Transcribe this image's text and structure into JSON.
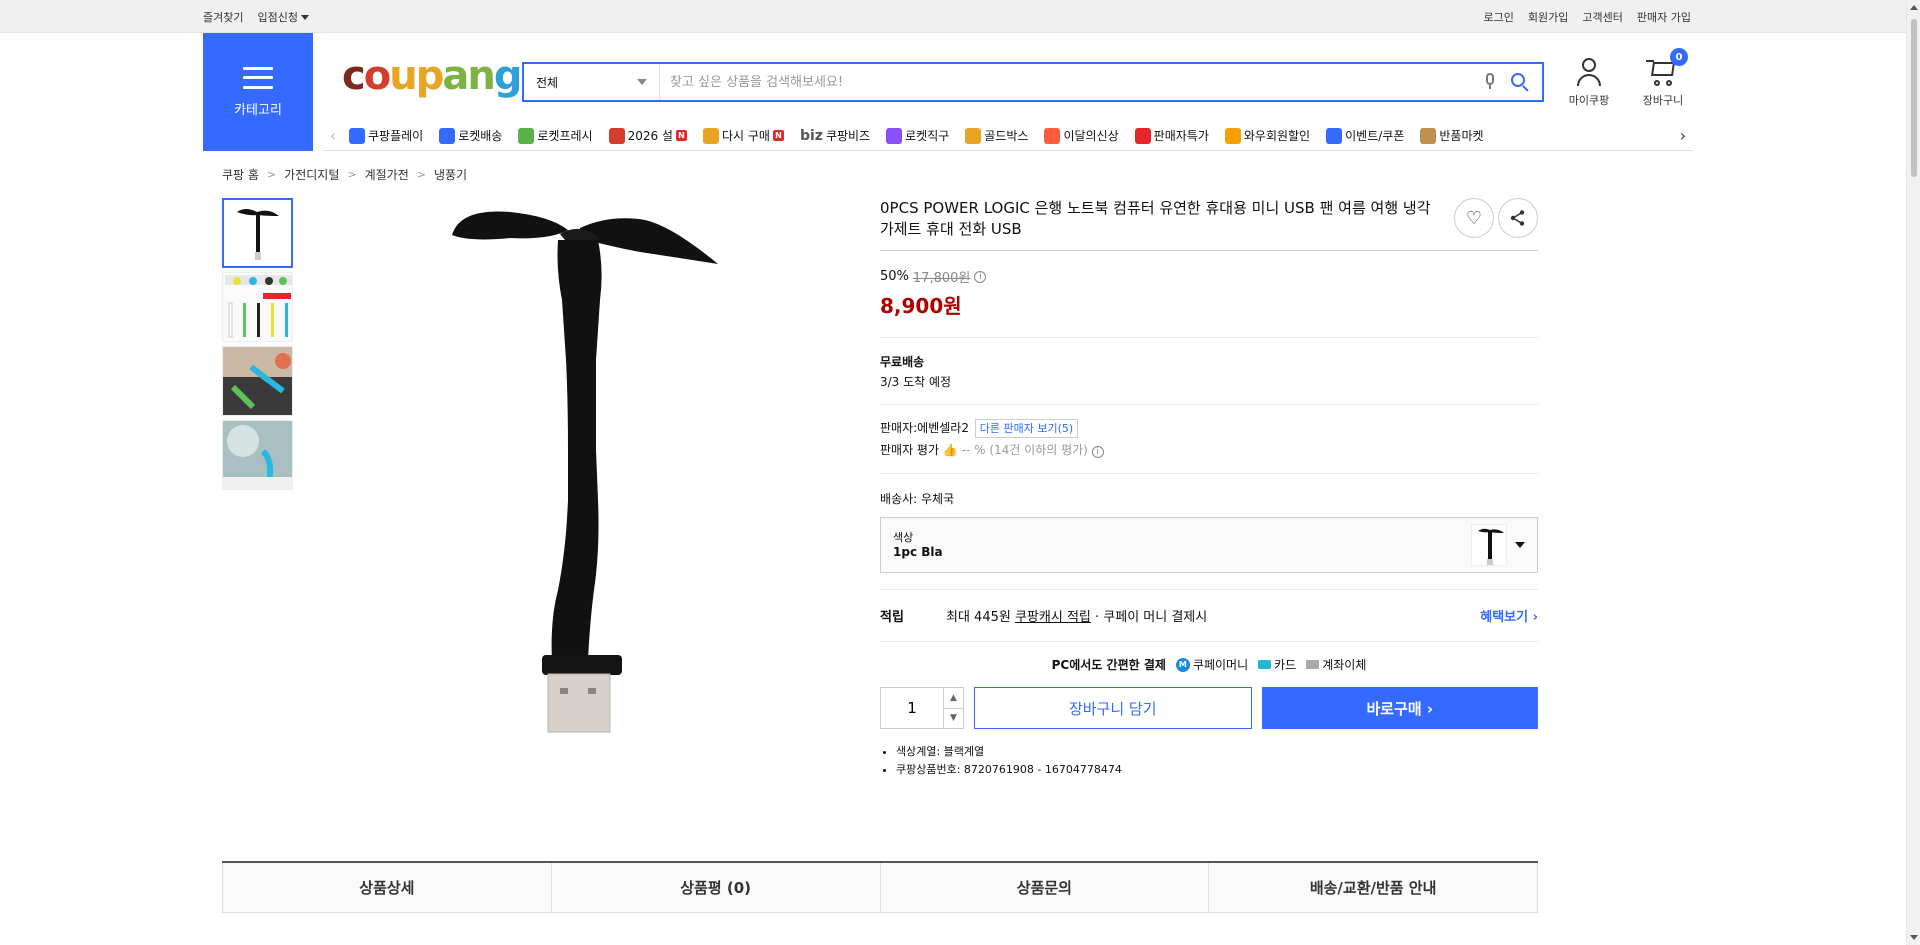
{
  "topbar": {
    "favorites": "즐겨찾기",
    "store_apply": "입점신청",
    "login": "로그인",
    "signup": "회원가입",
    "customer_center": "고객센터",
    "seller_signup": "판매자 가입"
  },
  "header": {
    "category_label": "카테고리",
    "logo_parts": [
      "c",
      "o",
      "u",
      "p",
      "a",
      "n",
      "g"
    ],
    "search_scope": "전체",
    "search_placeholder": "찾고 싶은 상품을 검색해보세요!",
    "my_coupang": "마이쿠팡",
    "cart_label": "장바구니",
    "cart_count": "0"
  },
  "quick_nav": [
    {
      "label": "쿠팡플레이",
      "icon": "play-icon",
      "color": "#346aff"
    },
    {
      "label": "로켓배송",
      "icon": "rocket-icon",
      "color": "#346aff"
    },
    {
      "label": "로켓프레시",
      "icon": "rocket-fresh-icon",
      "color": "#5ab24a"
    },
    {
      "label": "2026 설",
      "icon": "gift-icon",
      "color": "#d43d2b",
      "new": "N"
    },
    {
      "label": "다시 구매",
      "icon": "rebuy-icon",
      "color": "#e8a423",
      "new": "N"
    },
    {
      "label": "쿠팡비즈",
      "icon": "biz-icon",
      "color": "#555555",
      "prefix": "biz"
    },
    {
      "label": "로켓직구",
      "icon": "global-icon",
      "color": "#8a4ff7"
    },
    {
      "label": "골드박스",
      "icon": "goldbox-icon",
      "color": "#e8a423"
    },
    {
      "label": "이달의신상",
      "icon": "newitem-icon",
      "color": "#ff5a3c"
    },
    {
      "label": "판매자특가",
      "icon": "seller-deal-icon",
      "color": "#e52528"
    },
    {
      "label": "와우회원할인",
      "icon": "wow-icon",
      "color": "#f2a100"
    },
    {
      "label": "이벤트/쿠폰",
      "icon": "coupon-icon",
      "color": "#346aff"
    },
    {
      "label": "반품마켓",
      "icon": "return-market-icon",
      "color": "#c09050"
    }
  ],
  "breadcrumb": [
    "쿠팡 홈",
    "가전디지털",
    "계절가전",
    "냉풍기"
  ],
  "product": {
    "title": "0PCS POWER LOGIC 은행 노트북 컴퓨터 유연한 휴대용 미니 USB 팬 여름 여행 냉각 가제트 휴대 전화 USB",
    "discount_rate": "50%",
    "original_price": "17,800원",
    "price": "8,900원",
    "shipping_label": "무료배송",
    "arrival": "3/3 도착 예정",
    "seller_label": "판매자:",
    "seller_name": "에벤셀라2",
    "other_sellers": "다른 판매자 보기(5)",
    "seller_rating_label": "판매자 평가",
    "seller_rating_value": "-- %",
    "seller_rating_note": "(14건 이하의 평가)",
    "courier_label": "배송사:",
    "courier": "우체국",
    "option_label": "색상",
    "option_value": "1pc Bla",
    "reward_label": "적립",
    "reward_amount": "최대 445원",
    "reward_cash": "쿠팡캐시 적립",
    "reward_suffix": "· 쿠페이 머니 결제시",
    "reward_more": "혜택보기",
    "pay_title": "PC에서도 간편한 결제",
    "pay_money": "쿠페이머니",
    "pay_card": "카드",
    "pay_bank": "계좌이체",
    "quantity": "1",
    "add_cart": "장바구니 담기",
    "buy_now": "바로구매",
    "attr_color": "색상계열: 블랙계열",
    "attr_id": "쿠팡상품번호: 8720761908 - 16704778474"
  },
  "tabs": [
    "상품상세",
    "상품평 (0)",
    "상품문의",
    "배송/교환/반품 안내"
  ],
  "colors": {
    "accent": "#346aff",
    "price": "#ae0000"
  }
}
